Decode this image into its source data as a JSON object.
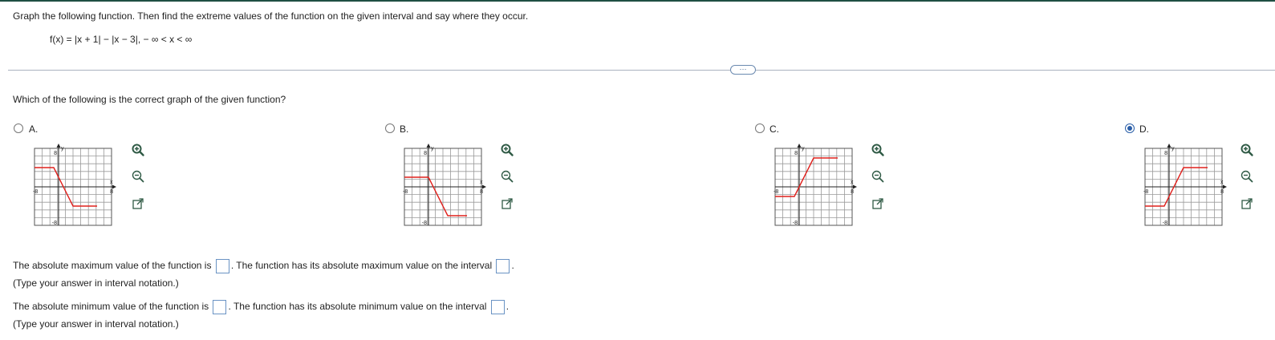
{
  "question": "Graph the following function. Then find the extreme values of the function on the given interval and say where they occur.",
  "formula": "f(x) = |x + 1| − |x − 3|,  − ∞ < x < ∞",
  "more_button": "···",
  "prompt": "Which of the following is the correct graph of the given function?",
  "options": [
    {
      "label": "A.",
      "selected": false
    },
    {
      "label": "B.",
      "selected": false
    },
    {
      "label": "C.",
      "selected": false
    },
    {
      "label": "D.",
      "selected": true
    }
  ],
  "graph": {
    "x_axis_label": "x",
    "y_axis_label": "y",
    "x_min_label": "-8",
    "x_max_label": "8",
    "y_max_label": "8",
    "y_min_label": "-8",
    "curve_color": "#e0201c"
  },
  "chart_data": [
    {
      "type": "line",
      "option": "A",
      "x": [
        -8,
        -1,
        3,
        8
      ],
      "y": [
        4,
        4,
        -4,
        -4
      ],
      "xlim": [
        -8,
        8
      ],
      "ylim": [
        -8,
        8
      ],
      "grid": true
    },
    {
      "type": "line",
      "option": "B",
      "x": [
        -8,
        0,
        4,
        8
      ],
      "y": [
        2,
        2,
        -6,
        -6
      ],
      "xlim": [
        -8,
        8
      ],
      "ylim": [
        -8,
        8
      ],
      "grid": true
    },
    {
      "type": "line",
      "option": "C",
      "x": [
        -8,
        -1,
        3,
        8
      ],
      "y": [
        -2,
        -2,
        6,
        6
      ],
      "xlim": [
        -8,
        8
      ],
      "ylim": [
        -8,
        8
      ],
      "grid": true
    },
    {
      "type": "line",
      "option": "D",
      "x": [
        -8,
        -1,
        3,
        8
      ],
      "y": [
        -4,
        -4,
        4,
        4
      ],
      "xlim": [
        -8,
        8
      ],
      "ylim": [
        -8,
        8
      ],
      "grid": true
    }
  ],
  "tools": [
    "zoom-in-icon",
    "zoom-out-icon",
    "popout-icon"
  ],
  "answers": {
    "max_text1": "The absolute maximum value of the function is",
    "max_text2": "The function has its absolute maximum value on the interval",
    "max_value": "",
    "max_interval": "",
    "max_hint": "(Type your answer in interval notation.)",
    "min_text1": "The absolute minimum value of the function is",
    "min_text2": "The function has its absolute minimum value on the interval",
    "min_value": "",
    "min_interval": "",
    "min_hint": "(Type your answer in interval notation.)"
  }
}
